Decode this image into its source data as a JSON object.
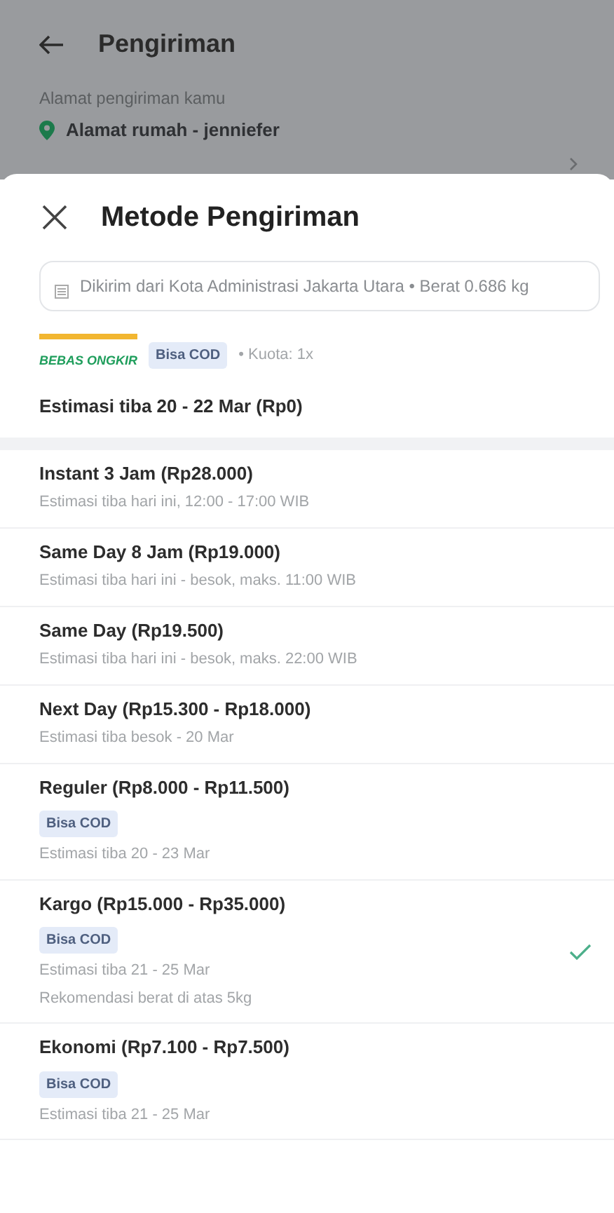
{
  "header": {
    "title": "Pengiriman",
    "address_label": "Alamat pengiriman kamu",
    "address": "Alamat rumah - jenniefer"
  },
  "sheet": {
    "title": "Metode Pengiriman",
    "origin_info": "Dikirim dari Kota Administrasi Jakarta Utara • Berat 0.686 kg",
    "promo": {
      "logo_text": "BEBAS ONGKIR",
      "badge": "Bisa COD",
      "quota": "• Kuota: 1x",
      "estimate": "Estimasi tiba 20 - 22 Mar (Rp0)"
    },
    "options": [
      {
        "title": "Instant 3 Jam (Rp28.000)",
        "lines": [
          "Estimasi tiba hari ini, 12:00 - 17:00 WIB"
        ],
        "selected": false
      },
      {
        "title": "Same Day 8 Jam (Rp19.000)",
        "lines": [
          "Estimasi tiba hari ini - besok, maks. 11:00 WIB"
        ],
        "selected": false
      },
      {
        "title": "Same Day (Rp19.500)",
        "lines": [
          "Estimasi tiba hari ini - besok, maks. 22:00 WIB"
        ],
        "selected": false
      },
      {
        "title": "Next Day (Rp15.300 - Rp18.000)",
        "lines": [
          "Estimasi tiba besok - 20 Mar"
        ],
        "selected": false
      },
      {
        "title": "Reguler (Rp8.000 - Rp11.500)",
        "cod": "Bisa COD",
        "lines": [
          "Estimasi tiba 20 - 23 Mar"
        ],
        "selected": false
      },
      {
        "title": "Kargo (Rp15.000 - Rp35.000)",
        "cod": "Bisa COD",
        "lines": [
          "Estimasi tiba 21 - 25 Mar",
          "Rekomendasi berat di atas 5kg"
        ],
        "selected": true
      },
      {
        "title": "Ekonomi (Rp7.100 - Rp7.500)",
        "cod": "Bisa COD",
        "lines": [
          "Estimasi tiba 21 - 25 Mar"
        ],
        "selected": false
      }
    ]
  }
}
